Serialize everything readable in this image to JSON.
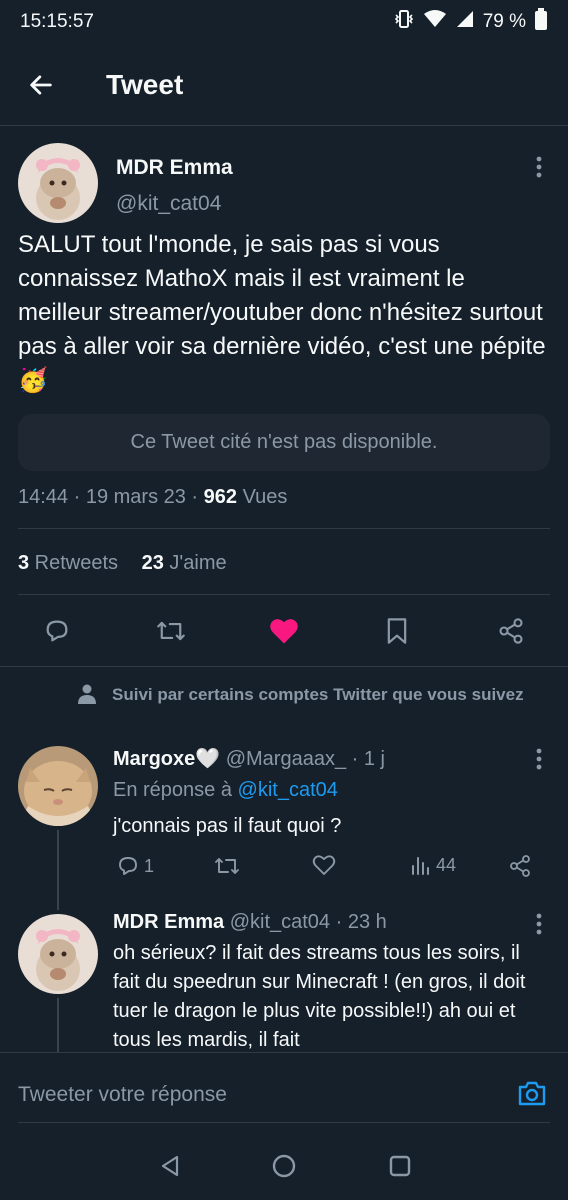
{
  "status_bar": {
    "time": "15:15:57",
    "battery": "79 %"
  },
  "header": {
    "title": "Tweet"
  },
  "tweet": {
    "author_name": "MDR Emma",
    "author_handle": "@kit_cat04",
    "text": "SALUT tout l'monde, je sais pas si vous connaissez MathoX mais il est vraiment le meilleur streamer/youtuber donc n'hésitez surtout pas à aller voir sa dernière vidéo, c'est une pépite 🥳",
    "quoted_unavailable": "Ce Tweet cité n'est pas disponible.",
    "time": "14:44 · 19 mars 23 · ",
    "views_count": "962",
    "views_label": " Vues",
    "retweets_count": "3",
    "retweets_label": " Retweets",
    "likes_count": "23",
    "likes_label": " J'aime",
    "liked": true
  },
  "followed_notice": "Suivi par certains comptes Twitter que vous suivez",
  "replies": [
    {
      "name": "Margoxe🤍",
      "handle": "@Margaaax_",
      "age": " · 1 j",
      "reply_to_label": "En réponse à ",
      "reply_to_handle": "@kit_cat04",
      "text": "j'connais pas il faut quoi ?",
      "reply_count": "1",
      "views": "44"
    },
    {
      "name": "MDR Emma",
      "handle": "@kit_cat04",
      "age": " · 23 h",
      "text": "oh sérieux? il fait des streams tous les soirs, il fait du speedrun sur Minecraft ! (en gros, il doit tuer le dragon le plus vite possible!!) ah oui et tous les mardis, il fait"
    }
  ],
  "composer": {
    "placeholder": "Tweeter votre réponse"
  },
  "colors": {
    "accent": "#1d9bf0",
    "like": "#f91880",
    "background": "#15202b",
    "muted": "#8b98a5"
  }
}
